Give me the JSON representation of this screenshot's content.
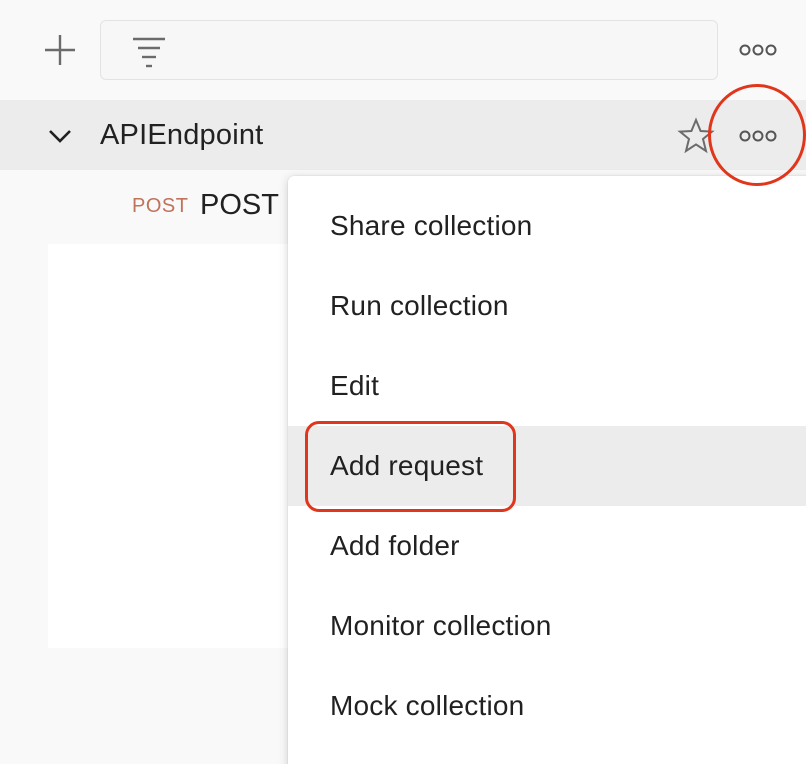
{
  "toolbar": {
    "add_icon": "plus-icon",
    "filter_icon": "filter-icon",
    "more_icon": "more-horizontal-icon"
  },
  "collection": {
    "name": "APIEndpoint",
    "expanded": true,
    "chevron_icon": "chevron-down-icon",
    "star_icon": "star-outline-icon",
    "more_icon": "more-horizontal-icon"
  },
  "requests": [
    {
      "method": "POST",
      "name": "POST"
    }
  ],
  "menu": {
    "items": [
      {
        "label": "Share collection"
      },
      {
        "label": "Run collection"
      },
      {
        "label": "Edit"
      },
      {
        "label": "Add request",
        "active": true
      },
      {
        "label": "Add folder"
      },
      {
        "label": "Monitor collection"
      },
      {
        "label": "Mock collection"
      }
    ]
  },
  "colors": {
    "annotation_red": "#e0361c",
    "method_post": "#c0725a",
    "hover_bg": "#ececec"
  }
}
